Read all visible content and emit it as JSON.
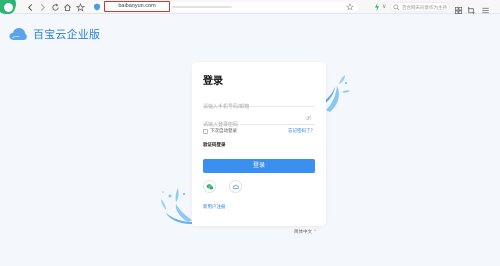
{
  "browser": {
    "url": "baibaoyun.com",
    "search_placeholder": "百合网未同意作为主持"
  },
  "brand": {
    "name": "百宝云企业版"
  },
  "login": {
    "title": "登录",
    "account_placeholder": "请输入手机号码/邮箱",
    "password_placeholder": "请输入登录密码",
    "remember_label": "下次自动登录",
    "forgot_label": "忘记密码了？",
    "code_login_label": "验证码登录",
    "submit_label": "登录",
    "register_label": "新用户注册"
  },
  "footer": {
    "language": "简体中文 ⌃"
  },
  "colors": {
    "accent": "#3b8ff0",
    "brand": "#2a83d8",
    "url_highlight": "#d7353a",
    "wechat": "#2aae67"
  },
  "icons": {
    "browser": "browser-logo-icon",
    "back": "back-arrow-icon",
    "forward": "forward-arrow-icon",
    "refresh": "refresh-icon",
    "home": "home-icon",
    "star": "star-icon",
    "eye": "eye-icon",
    "wechat": "wechat-icon",
    "sso": "sso-icon"
  }
}
